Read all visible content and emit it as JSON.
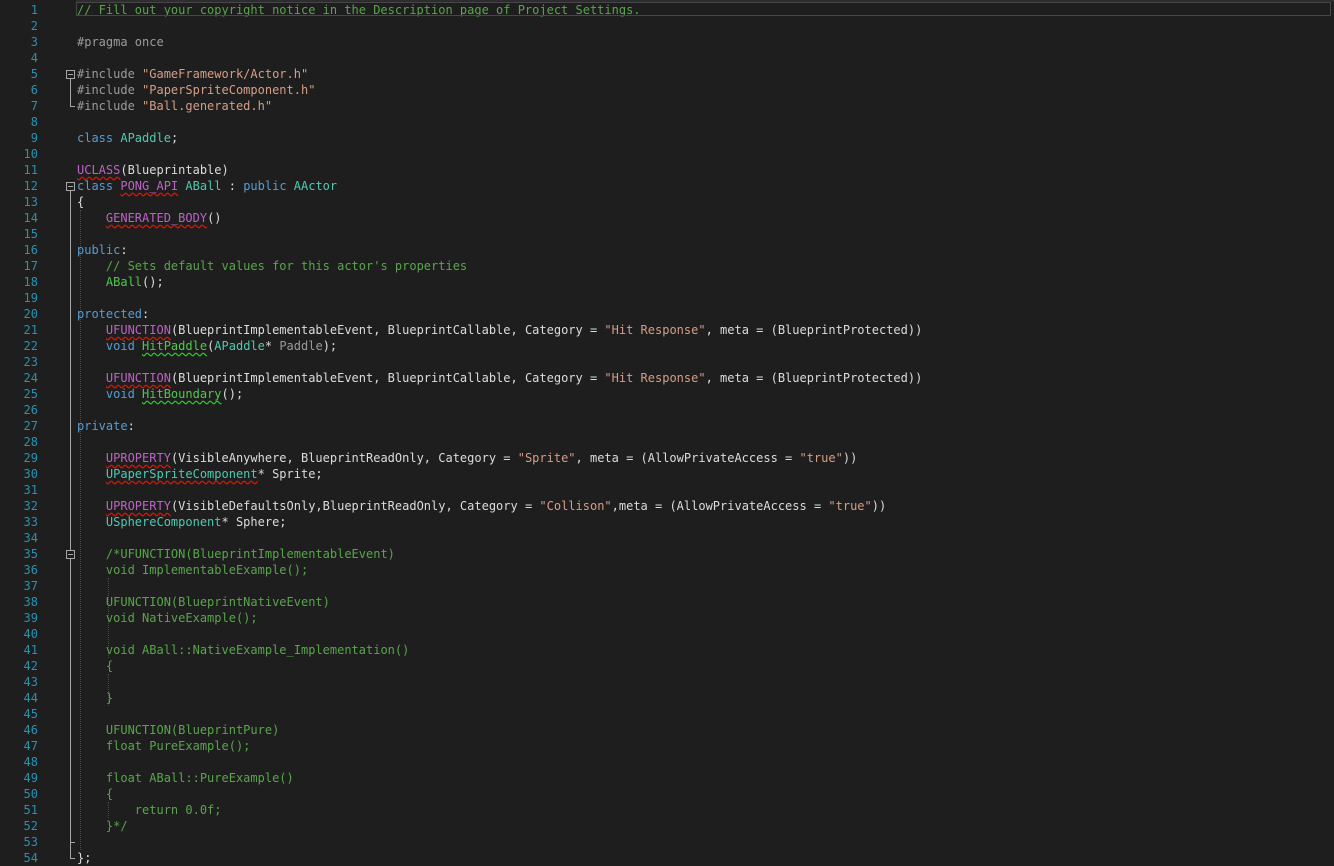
{
  "editor": {
    "line_numbers": [
      "1",
      "2",
      "3",
      "4",
      "5",
      "6",
      "7",
      "8",
      "9",
      "10",
      "11",
      "12",
      "13",
      "14",
      "15",
      "16",
      "17",
      "18",
      "19",
      "20",
      "21",
      "22",
      "23",
      "24",
      "25",
      "26",
      "27",
      "28",
      "29",
      "30",
      "31",
      "32",
      "33",
      "34",
      "35",
      "36",
      "37",
      "38",
      "39",
      "40",
      "41",
      "42",
      "43",
      "44",
      "45",
      "46",
      "47",
      "48",
      "49",
      "50",
      "51",
      "52",
      "53",
      "54"
    ],
    "lines": [
      [
        {
          "t": "// Fill out your copyright notice in the Description page of Project Settings.",
          "c": "c"
        }
      ],
      [],
      [
        {
          "t": "#pragma once",
          "c": "pre"
        }
      ],
      [],
      [
        {
          "t": "#include ",
          "c": "pre"
        },
        {
          "t": "\"GameFramework/Actor.h\"",
          "c": "s"
        }
      ],
      [
        {
          "t": "#include ",
          "c": "pre"
        },
        {
          "t": "\"PaperSpriteComponent.h\"",
          "c": "s"
        }
      ],
      [
        {
          "t": "#include ",
          "c": "pre"
        },
        {
          "t": "\"Ball.generated.h\"",
          "c": "s"
        }
      ],
      [],
      [
        {
          "t": "class ",
          "c": "k"
        },
        {
          "t": "APaddle",
          "c": "t"
        },
        {
          "t": ";",
          "c": "p"
        }
      ],
      [],
      [
        {
          "t": "UCLASS",
          "c": "mv",
          "sq": "red"
        },
        {
          "t": "(Blueprintable)",
          "c": "p"
        }
      ],
      [
        {
          "t": "class ",
          "c": "k"
        },
        {
          "t": "PONG_API",
          "c": "mv",
          "sq": "red"
        },
        {
          "t": " ",
          "c": "p"
        },
        {
          "t": "ABall",
          "c": "t"
        },
        {
          "t": " : ",
          "c": "p"
        },
        {
          "t": "public ",
          "c": "k"
        },
        {
          "t": "AActor",
          "c": "t"
        }
      ],
      [
        {
          "t": "{",
          "c": "p"
        }
      ],
      [
        {
          "t": "    ",
          "c": "p"
        },
        {
          "t": "GENERATED_BODY",
          "c": "mv",
          "sq": "red"
        },
        {
          "t": "()",
          "c": "p"
        }
      ],
      [],
      [
        {
          "t": "public",
          "c": "k"
        },
        {
          "t": ":",
          "c": "p"
        }
      ],
      [
        {
          "t": "    ",
          "c": "p"
        },
        {
          "t": "// Sets default values for this actor's properties",
          "c": "c"
        }
      ],
      [
        {
          "t": "    ",
          "c": "p"
        },
        {
          "t": "ABall",
          "c": "fd"
        },
        {
          "t": "();",
          "c": "p"
        }
      ],
      [],
      [
        {
          "t": "protected",
          "c": "k"
        },
        {
          "t": ":",
          "c": "p"
        }
      ],
      [
        {
          "t": "    ",
          "c": "p"
        },
        {
          "t": "UFUNCTION",
          "c": "mv",
          "sq": "red"
        },
        {
          "t": "(BlueprintImplementableEvent, BlueprintCallable, Category = ",
          "c": "p"
        },
        {
          "t": "\"Hit Response\"",
          "c": "s"
        },
        {
          "t": ", meta = (BlueprintProtected))",
          "c": "p"
        }
      ],
      [
        {
          "t": "    ",
          "c": "p"
        },
        {
          "t": "void ",
          "c": "k"
        },
        {
          "t": "HitPaddle",
          "c": "fd",
          "sq": "green"
        },
        {
          "t": "(",
          "c": "p"
        },
        {
          "t": "APaddle",
          "c": "t"
        },
        {
          "t": "* ",
          "c": "p"
        },
        {
          "t": "Paddle",
          "c": "prm"
        },
        {
          "t": ");",
          "c": "p"
        }
      ],
      [],
      [
        {
          "t": "    ",
          "c": "p"
        },
        {
          "t": "UFUNCTION",
          "c": "mv",
          "sq": "red"
        },
        {
          "t": "(BlueprintImplementableEvent, BlueprintCallable, Category = ",
          "c": "p"
        },
        {
          "t": "\"Hit Response\"",
          "c": "s"
        },
        {
          "t": ", meta = (BlueprintProtected))",
          "c": "p"
        }
      ],
      [
        {
          "t": "    ",
          "c": "p"
        },
        {
          "t": "void ",
          "c": "k"
        },
        {
          "t": "HitBoundary",
          "c": "fd",
          "sq": "green"
        },
        {
          "t": "();",
          "c": "p"
        }
      ],
      [],
      [
        {
          "t": "private",
          "c": "k"
        },
        {
          "t": ":",
          "c": "p"
        }
      ],
      [],
      [
        {
          "t": "    ",
          "c": "p"
        },
        {
          "t": "UPROPERTY",
          "c": "mv",
          "sq": "red"
        },
        {
          "t": "(VisibleAnywhere, BlueprintReadOnly, Category = ",
          "c": "p"
        },
        {
          "t": "\"Sprite\"",
          "c": "s"
        },
        {
          "t": ", meta = (AllowPrivateAccess = ",
          "c": "p"
        },
        {
          "t": "\"true\"",
          "c": "s"
        },
        {
          "t": "))",
          "c": "p"
        }
      ],
      [
        {
          "t": "    ",
          "c": "p"
        },
        {
          "t": "UPaperSpriteComponent",
          "c": "t",
          "sq": "red"
        },
        {
          "t": "* Sprite;",
          "c": "p"
        }
      ],
      [],
      [
        {
          "t": "    ",
          "c": "p"
        },
        {
          "t": "UPROPERTY",
          "c": "mv",
          "sq": "red"
        },
        {
          "t": "(VisibleDefaultsOnly,BlueprintReadOnly, Category = ",
          "c": "p"
        },
        {
          "t": "\"Collison\"",
          "c": "s"
        },
        {
          "t": ",meta = (AllowPrivateAccess = ",
          "c": "p"
        },
        {
          "t": "\"true\"",
          "c": "s"
        },
        {
          "t": "))",
          "c": "p"
        }
      ],
      [
        {
          "t": "    ",
          "c": "p"
        },
        {
          "t": "USphereComponent",
          "c": "t"
        },
        {
          "t": "* Sphere;",
          "c": "p"
        }
      ],
      [],
      [
        {
          "t": "    ",
          "c": "p"
        },
        {
          "t": "/*UFUNCTION(BlueprintImplementableEvent)",
          "c": "c"
        }
      ],
      [
        {
          "t": "    ",
          "c": "p"
        },
        {
          "t": "void ImplementableExample();",
          "c": "c"
        }
      ],
      [],
      [
        {
          "t": "    ",
          "c": "p"
        },
        {
          "t": "UFUNCTION(BlueprintNativeEvent)",
          "c": "c"
        }
      ],
      [
        {
          "t": "    ",
          "c": "p"
        },
        {
          "t": "void NativeExample();",
          "c": "c"
        }
      ],
      [],
      [
        {
          "t": "    ",
          "c": "p"
        },
        {
          "t": "void ABall::NativeExample_Implementation()",
          "c": "c"
        }
      ],
      [
        {
          "t": "    ",
          "c": "p"
        },
        {
          "t": "{",
          "c": "c"
        }
      ],
      [],
      [
        {
          "t": "    ",
          "c": "p"
        },
        {
          "t": "}",
          "c": "c"
        }
      ],
      [],
      [
        {
          "t": "    ",
          "c": "p"
        },
        {
          "t": "UFUNCTION(BlueprintPure)",
          "c": "c"
        }
      ],
      [
        {
          "t": "    ",
          "c": "p"
        },
        {
          "t": "float PureExample();",
          "c": "c"
        }
      ],
      [],
      [
        {
          "t": "    ",
          "c": "p"
        },
        {
          "t": "float ABall::PureExample()",
          "c": "c"
        }
      ],
      [
        {
          "t": "    ",
          "c": "p"
        },
        {
          "t": "{",
          "c": "c"
        }
      ],
      [
        {
          "t": "        ",
          "c": "p"
        },
        {
          "t": "return 0.0f;",
          "c": "c"
        }
      ],
      [
        {
          "t": "    ",
          "c": "p"
        },
        {
          "t": "}*/",
          "c": "c"
        }
      ],
      [],
      [
        {
          "t": "};",
          "c": "p"
        }
      ]
    ]
  },
  "colors": {
    "background": "#1e1e1e",
    "line_number": "#2b91af",
    "keyword": "#569cd6",
    "type": "#4ec9b0",
    "string": "#d69d85",
    "comment": "#57a64a",
    "macro": "#bd63c5"
  }
}
